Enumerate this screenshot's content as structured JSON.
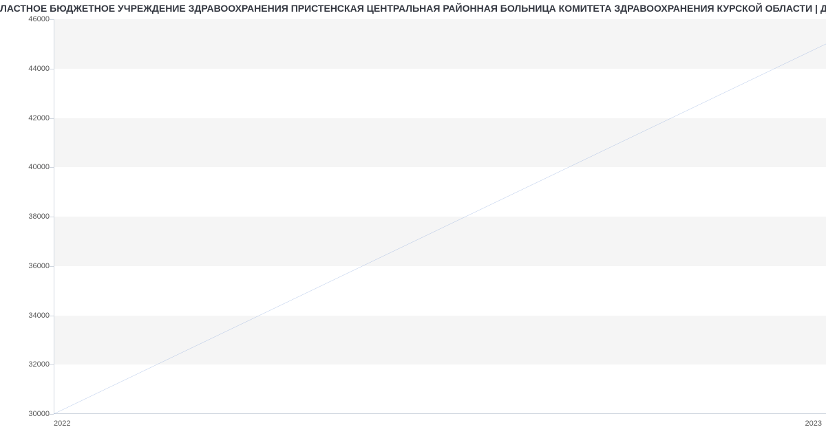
{
  "title": "ЛАСТНОЕ БЮДЖЕТНОЕ УЧРЕЖДЕНИЕ ЗДРАВООХРАНЕНИЯ ПРИСТЕНСКАЯ ЦЕНТРАЛЬНАЯ РАЙОННАЯ БОЛЬНИЦА  КОМИТЕТА ЗДРАВООХРАНЕНИЯ КУРСКОЙ ОБЛАСТИ | Данн",
  "chart_data": {
    "type": "line",
    "x": [
      "2022",
      "2023"
    ],
    "values": [
      30000,
      45000
    ],
    "title": "ЛАСТНОЕ БЮДЖЕТНОЕ УЧРЕЖДЕНИЕ ЗДРАВООХРАНЕНИЯ ПРИСТЕНСКАЯ ЦЕНТРАЛЬНАЯ РАЙОННАЯ БОЛЬНИЦА  КОМИТЕТА ЗДРАВООХРАНЕНИЯ КУРСКОЙ ОБЛАСТИ | Данн",
    "xlabel": "",
    "ylabel": "",
    "ylim": [
      30000,
      46000
    ],
    "y_ticks": [
      30000,
      32000,
      34000,
      36000,
      38000,
      40000,
      42000,
      44000,
      46000
    ],
    "line_color": "#7c9ed9"
  },
  "x_tick_labels": [
    "2022",
    "2023"
  ],
  "y_tick_labels": [
    "30000",
    "32000",
    "34000",
    "36000",
    "38000",
    "40000",
    "42000",
    "44000",
    "46000"
  ]
}
